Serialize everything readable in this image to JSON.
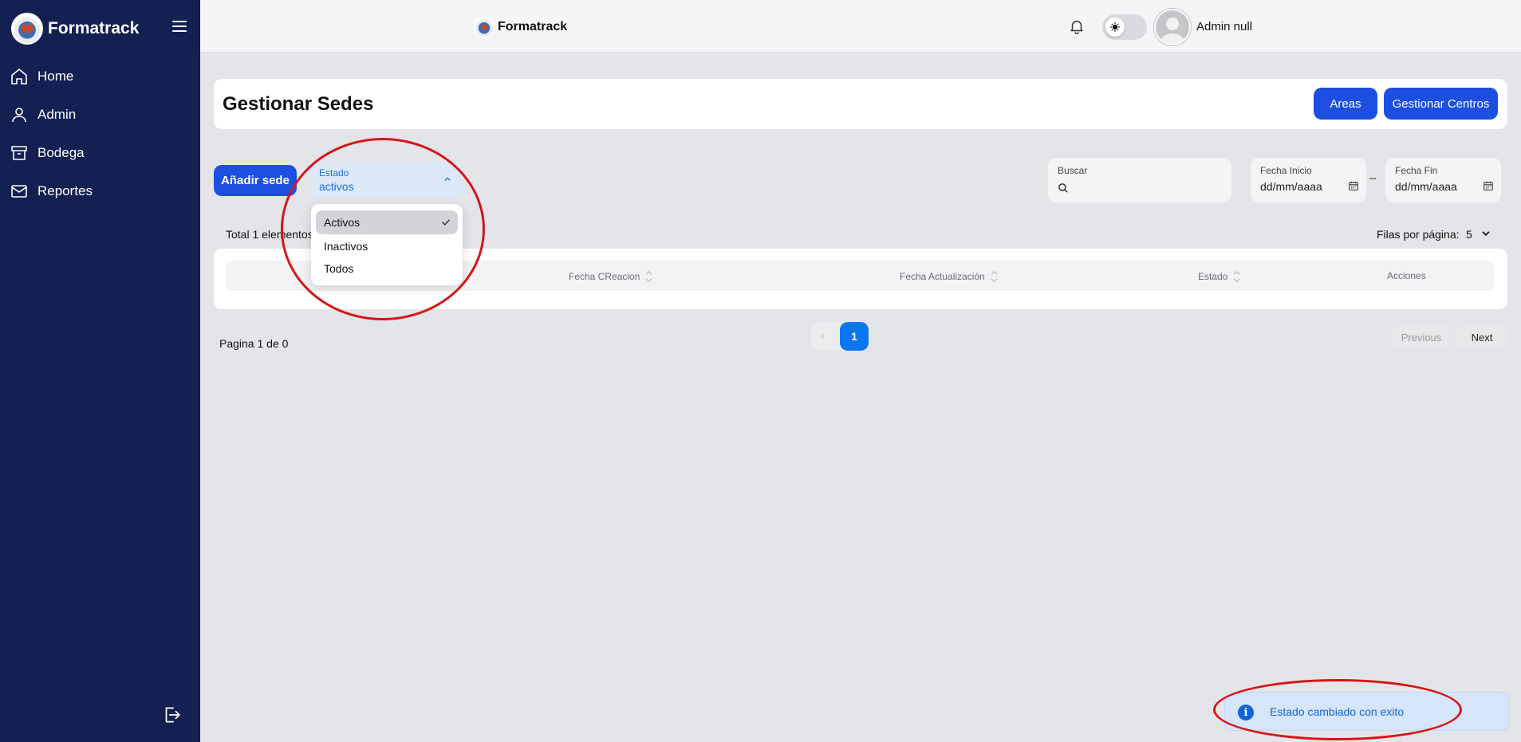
{
  "app": {
    "name": "Formatrack"
  },
  "sidebar": {
    "items": [
      {
        "label": "Home",
        "icon": "home-icon"
      },
      {
        "label": "Admin",
        "icon": "user-icon"
      },
      {
        "label": "Bodega",
        "icon": "archive-icon"
      },
      {
        "label": "Reportes",
        "icon": "mail-icon"
      }
    ]
  },
  "topbar": {
    "brand": "Formatrack",
    "username": "Admin null"
  },
  "header": {
    "title": "Gestionar Sedes",
    "areas_label": "Areas",
    "centros_label": "Gestionar Centros"
  },
  "filters": {
    "add_label": "Añadir sede",
    "estado_label": "Estado",
    "estado_value": "activos",
    "search_label": "Buscar",
    "fecha_inicio_label": "Fecha Inicio",
    "fecha_inicio_value": "dd/mm/aaaa",
    "fecha_fin_label": "Fecha Fin",
    "fecha_fin_value": "dd/mm/aaaa",
    "dash": "–"
  },
  "dropdown": {
    "options": [
      {
        "label": "Activos",
        "selected": true
      },
      {
        "label": "Inactivos",
        "selected": false
      },
      {
        "label": "Todos",
        "selected": false
      }
    ]
  },
  "table": {
    "total_label": "Total 1 elementos",
    "rows_per_page_label": "Filas por página:",
    "rows_per_page_value": "5",
    "columns": [
      "Fecha CReacion",
      "Fecha Actualización",
      "Estado",
      "Acciones"
    ]
  },
  "pagination": {
    "page_info": "Pagina 1 de 0",
    "prev_symbol": "‹",
    "current_page": "1",
    "previous_label": "Previous",
    "next_label": "Next"
  },
  "toast": {
    "message": "Estado cambiado con exito",
    "icon": "i"
  },
  "colors": {
    "sidebar": "#142052",
    "primary": "#1c4fe0",
    "page_active": "#0a76f0",
    "annotation": "#d4161b"
  }
}
